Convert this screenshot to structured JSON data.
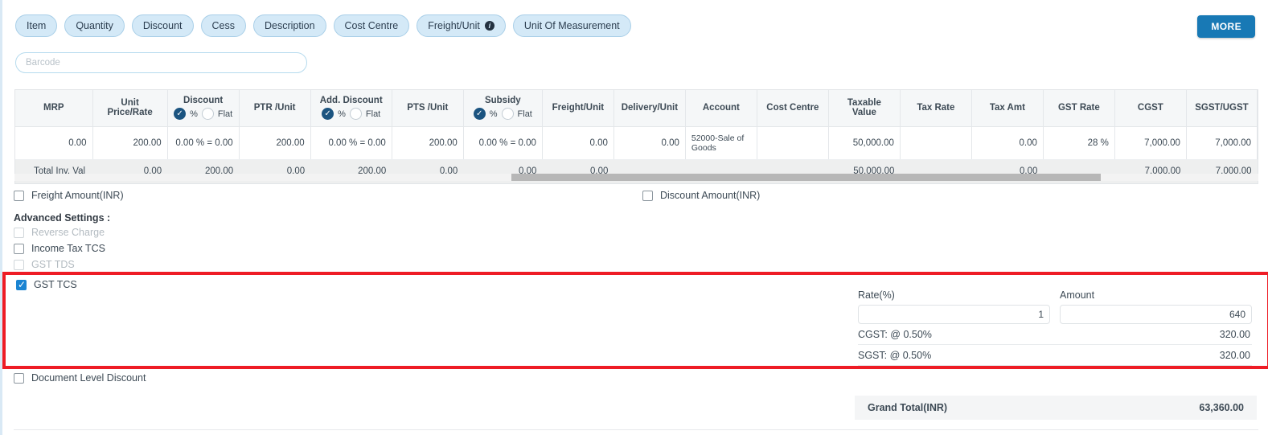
{
  "toolbar": {
    "chips": [
      {
        "label": "Item",
        "has_info": false
      },
      {
        "label": "Quantity",
        "has_info": false
      },
      {
        "label": "Discount",
        "has_info": false
      },
      {
        "label": "Cess",
        "has_info": false
      },
      {
        "label": "Description",
        "has_info": false
      },
      {
        "label": "Cost Centre",
        "has_info": false
      },
      {
        "label": "Freight/Unit",
        "has_info": true
      },
      {
        "label": "Unit Of Measurement",
        "has_info": false
      }
    ],
    "more_label": "MORE",
    "info_glyph": "i"
  },
  "barcode": {
    "placeholder": "Barcode",
    "value": ""
  },
  "table": {
    "columns": [
      {
        "title": "MRP",
        "toggle": null
      },
      {
        "title": "Unit Price/Rate",
        "toggle": null
      },
      {
        "title": "Discount",
        "toggle": {
          "on": "%",
          "off": "Flat"
        }
      },
      {
        "title": "PTR /Unit",
        "toggle": null
      },
      {
        "title": "Add. Discount",
        "toggle": {
          "on": "%",
          "off": "Flat"
        }
      },
      {
        "title": "PTS /Unit",
        "toggle": null
      },
      {
        "title": "Subsidy",
        "toggle": {
          "on": "%",
          "off": "Flat"
        }
      },
      {
        "title": "Freight/Unit",
        "toggle": null
      },
      {
        "title": "Delivery/Unit",
        "toggle": null
      },
      {
        "title": "Account",
        "toggle": null
      },
      {
        "title": "Cost Centre",
        "toggle": null
      },
      {
        "title": "Taxable Value",
        "toggle": null
      },
      {
        "title": "Tax Rate",
        "toggle": null
      },
      {
        "title": "Tax Amt",
        "toggle": null
      },
      {
        "title": "GST Rate",
        "toggle": null
      },
      {
        "title": "CGST",
        "toggle": null
      },
      {
        "title": "SGST/UGST",
        "toggle": null
      }
    ],
    "row": {
      "mrp": "0.00",
      "unit_price_rate": "200.00",
      "discount": "0.00 % = 0.00",
      "ptr_unit": "200.00",
      "add_discount": "0.00 % = 0.00",
      "pts_unit": "200.00",
      "subsidy": "0.00 % = 0.00",
      "freight_unit": "0.00",
      "delivery_unit": "0.00",
      "account": "52000-Sale of Goods",
      "cost_centre": "",
      "taxable_value": "50,000.00",
      "tax_rate": "",
      "tax_amt": "0.00",
      "gst_rate": "28 %",
      "cgst": "7,000.00",
      "sgst_ugst": "7,000.00"
    },
    "totals": {
      "label": "Total Inv. Val",
      "mrp": "",
      "unit_price_rate": "0.00",
      "discount": "200.00",
      "ptr_unit": "0.00",
      "add_discount": "200.00",
      "pts_unit": "0.00",
      "subsidy": "0.00",
      "freight_unit": "0.00",
      "delivery_unit": "",
      "account": "",
      "cost_centre": "",
      "taxable_value": "50,000.00",
      "tax_rate": "",
      "tax_amt": "0.00",
      "gst_rate": "",
      "cgst": "7,000.00",
      "sgst_ugst": "7,000.00"
    }
  },
  "options": {
    "freight_amount": {
      "label": "Freight Amount(INR)",
      "checked": false,
      "disabled": false
    },
    "discount_amount": {
      "label": "Discount Amount(INR)",
      "checked": false,
      "disabled": false
    },
    "advanced_title": "Advanced Settings :",
    "reverse_charge": {
      "label": "Reverse Charge",
      "checked": false,
      "disabled": true
    },
    "income_tax_tcs": {
      "label": "Income Tax TCS",
      "checked": false,
      "disabled": false
    },
    "gst_tds": {
      "label": "GST TDS",
      "checked": false,
      "disabled": true
    },
    "gst_tcs": {
      "label": "GST TCS",
      "checked": true,
      "disabled": false
    },
    "document_level_discount": {
      "label": "Document Level Discount",
      "checked": false,
      "disabled": false
    }
  },
  "gst_tcs_panel": {
    "rate_label": "Rate(%)",
    "rate_value": "1",
    "amount_label": "Amount",
    "amount_value": "640",
    "cgst_label": "CGST: @ 0.50%",
    "cgst_value": "320.00",
    "sgst_label": "SGST: @ 0.50%",
    "sgst_value": "320.00",
    "highlight_color": "#ee1c25"
  },
  "grand_total": {
    "label": "Grand Total(INR)",
    "value": "63,360.00"
  },
  "colors": {
    "accent": "#1879b5",
    "chip_bg": "#d4e9f7",
    "radio_on": "#1b5480",
    "checkbox_checked": "#1b84d2"
  }
}
